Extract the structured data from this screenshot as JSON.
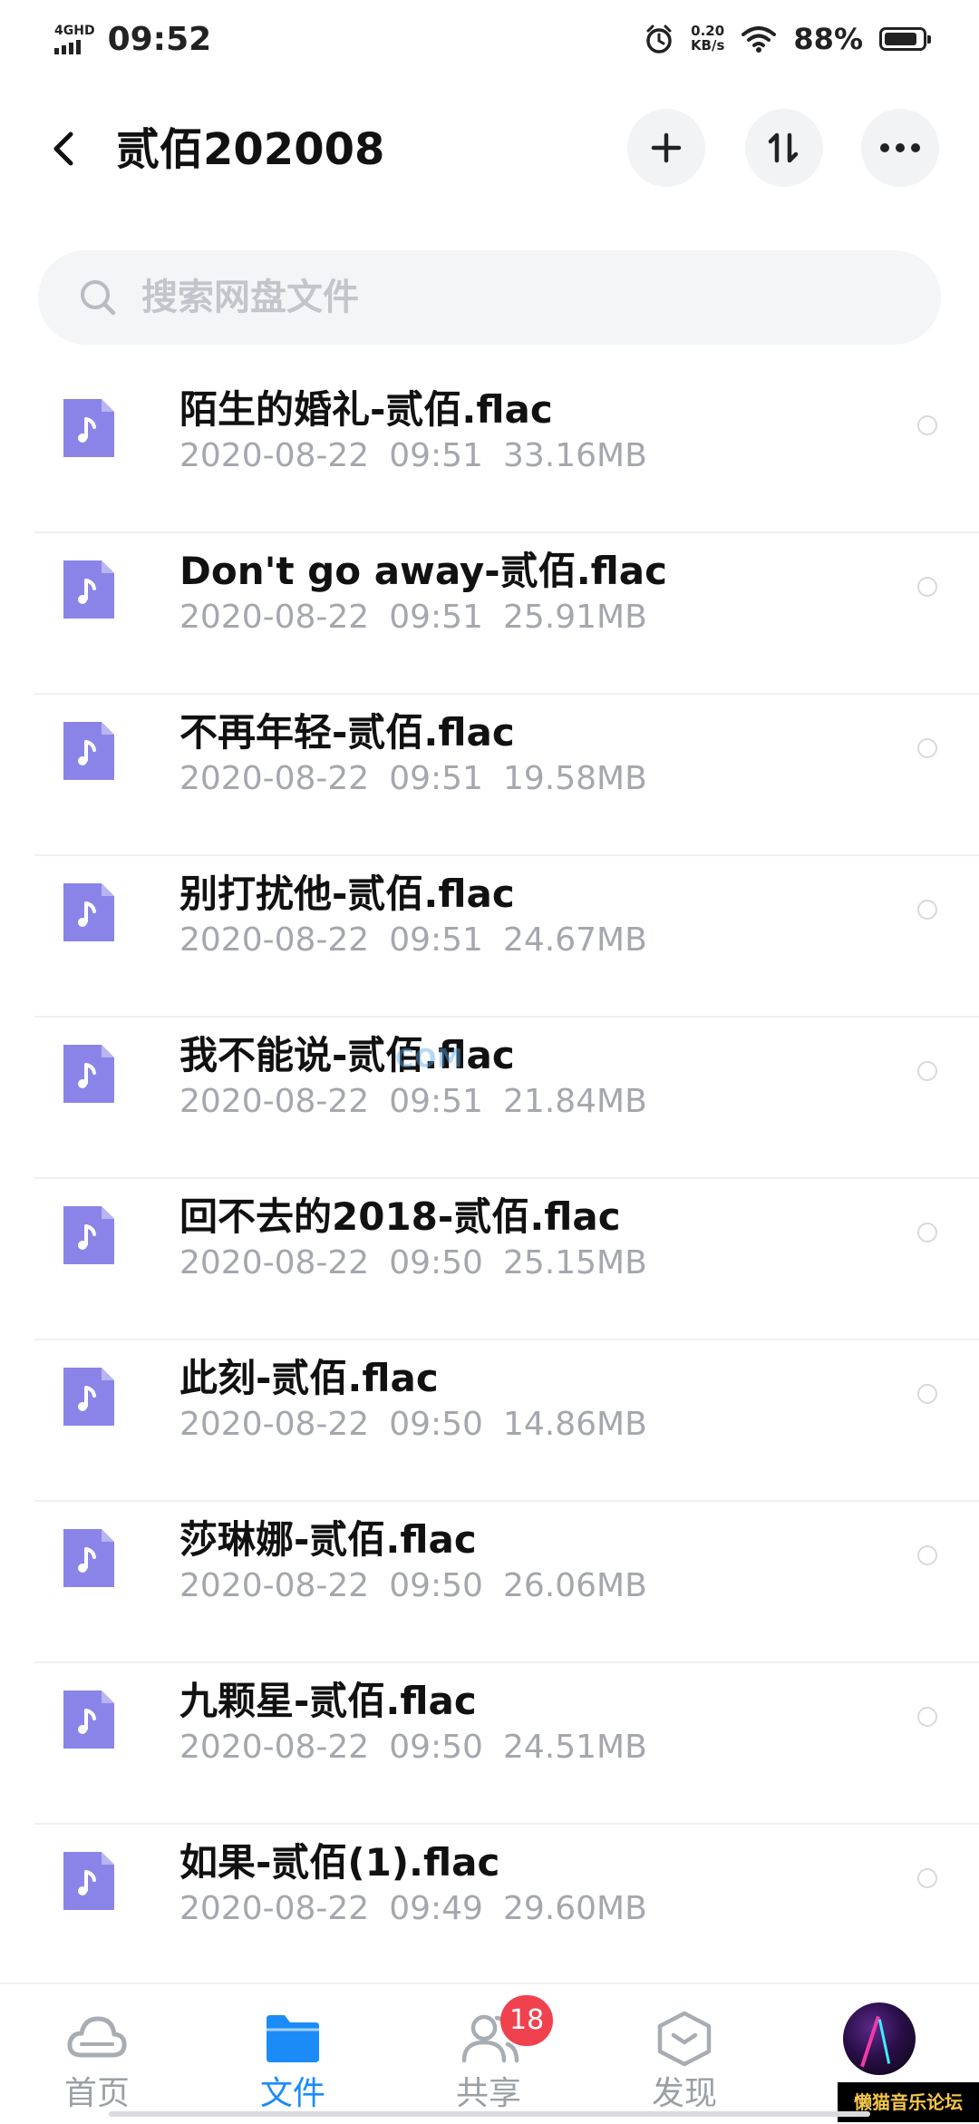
{
  "status_bar": {
    "network": "4GHD",
    "time": "09:52",
    "speed_value": "0.20",
    "speed_unit": "KB/s",
    "battery_percent": "88%",
    "battery_level": 0.88
  },
  "header": {
    "title": "贰佰202008"
  },
  "search": {
    "placeholder": "搜索网盘文件"
  },
  "files": [
    {
      "name": "陌生的婚礼-贰佰.flac",
      "date": "2020-08-22",
      "time": "09:51",
      "size": "33.16MB"
    },
    {
      "name": "Don't go away-贰佰.flac",
      "date": "2020-08-22",
      "time": "09:51",
      "size": "25.91MB"
    },
    {
      "name": "不再年轻-贰佰.flac",
      "date": "2020-08-22",
      "time": "09:51",
      "size": "19.58MB"
    },
    {
      "name": "别打扰他-贰佰.flac",
      "date": "2020-08-22",
      "time": "09:51",
      "size": "24.67MB"
    },
    {
      "name": "我不能说-贰佰.flac",
      "date": "2020-08-22",
      "time": "09:51",
      "size": "21.84MB"
    },
    {
      "name": "回不去的2018-贰佰.flac",
      "date": "2020-08-22",
      "time": "09:50",
      "size": "25.15MB"
    },
    {
      "name": "此刻-贰佰.flac",
      "date": "2020-08-22",
      "time": "09:50",
      "size": "14.86MB"
    },
    {
      "name": "莎琳娜-贰佰.flac",
      "date": "2020-08-22",
      "time": "09:50",
      "size": "26.06MB"
    },
    {
      "name": "九颗星-贰佰.flac",
      "date": "2020-08-22",
      "time": "09:50",
      "size": "24.51MB"
    },
    {
      "name": "如果-贰佰(1).flac",
      "date": "2020-08-22",
      "time": "09:49",
      "size": "29.60MB"
    }
  ],
  "watermark": "COM",
  "bottom_nav": {
    "home_label": "首页",
    "files_label": "文件",
    "share_label": "共享",
    "share_badge": "18",
    "discover_label": "发现"
  },
  "forum_tag": "懒猫音乐论坛",
  "colors": {
    "accent": "#1b8cf7",
    "file_icon": "#8b84e8",
    "badge": "#f0414f"
  }
}
